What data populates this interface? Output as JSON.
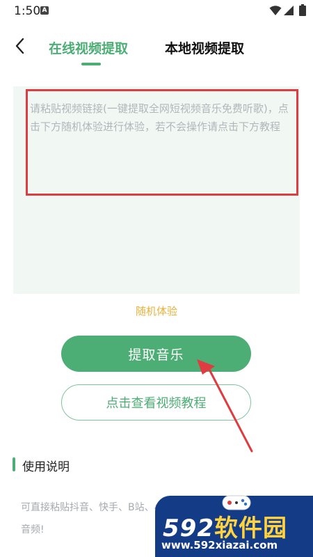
{
  "status_bar": {
    "time": "1:50",
    "notification_letter": "A"
  },
  "header": {
    "tabs": [
      {
        "label": "在线视频提取",
        "active": true
      },
      {
        "label": "本地视频提取",
        "active": false
      }
    ]
  },
  "link_input": {
    "placeholder": "请粘贴视频链接(一键提取全网短视频音乐免费听歌)，点击下方随机体验进行体验，若不会操作请点击下方教程",
    "value": ""
  },
  "random_trial_label": "随机体验",
  "extract_button_label": "提取音乐",
  "tutorial_button_label": "点击查看视频教程",
  "instructions": {
    "title": "使用说明",
    "text": "可直接粘贴抖音、快手、B站、小红书等视频地址进行提取音频!"
  },
  "watermark": {
    "logo_number": "592",
    "logo_text": "软件园",
    "url": "www.592xiazai.com"
  },
  "colors": {
    "accent_green": "#4dae75",
    "trial_orange": "#e8b23c",
    "annotation_red": "#e03b40",
    "panel_background": "#f1f8f4",
    "watermark_blue": "#143b85"
  },
  "icons": [
    "back-arrow-icon",
    "wifi-icon",
    "signal-icon",
    "battery-icon",
    "gamepad-icon"
  ]
}
